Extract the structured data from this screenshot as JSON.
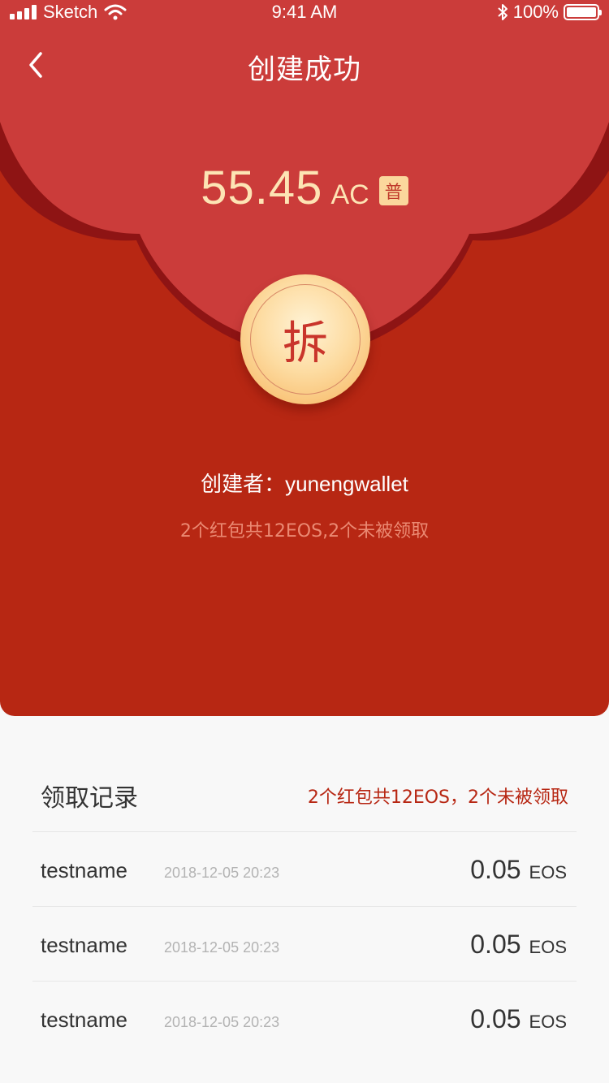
{
  "status_bar": {
    "carrier": "Sketch",
    "time": "9:41 AM",
    "battery": "100%"
  },
  "nav": {
    "title": "创建成功",
    "back_icon": "chevron-left-icon"
  },
  "envelope": {
    "amount": "55.45",
    "unit": "AC",
    "type_badge": "普",
    "open_button": "拆",
    "creator_label": "创建者：",
    "creator_name": "yunengwallet",
    "summary": "2个红包共12EOS,2个未被领取"
  },
  "records": {
    "title": "领取记录",
    "summary": "2个红包共12EOS，2个未被领取",
    "items": [
      {
        "name": "testname",
        "time": "2018-12-05 20:23",
        "amount": "0.05",
        "unit": "EOS"
      },
      {
        "name": "testname",
        "time": "2018-12-05 20:23",
        "amount": "0.05",
        "unit": "EOS"
      },
      {
        "name": "testname",
        "time": "2018-12-05 20:23",
        "amount": "0.05",
        "unit": "EOS"
      }
    ]
  },
  "colors": {
    "envelope_red": "#b72713",
    "flap_red": "#cb3c3a",
    "gold_text": "#fde4b4",
    "accent_red": "#b72713"
  }
}
